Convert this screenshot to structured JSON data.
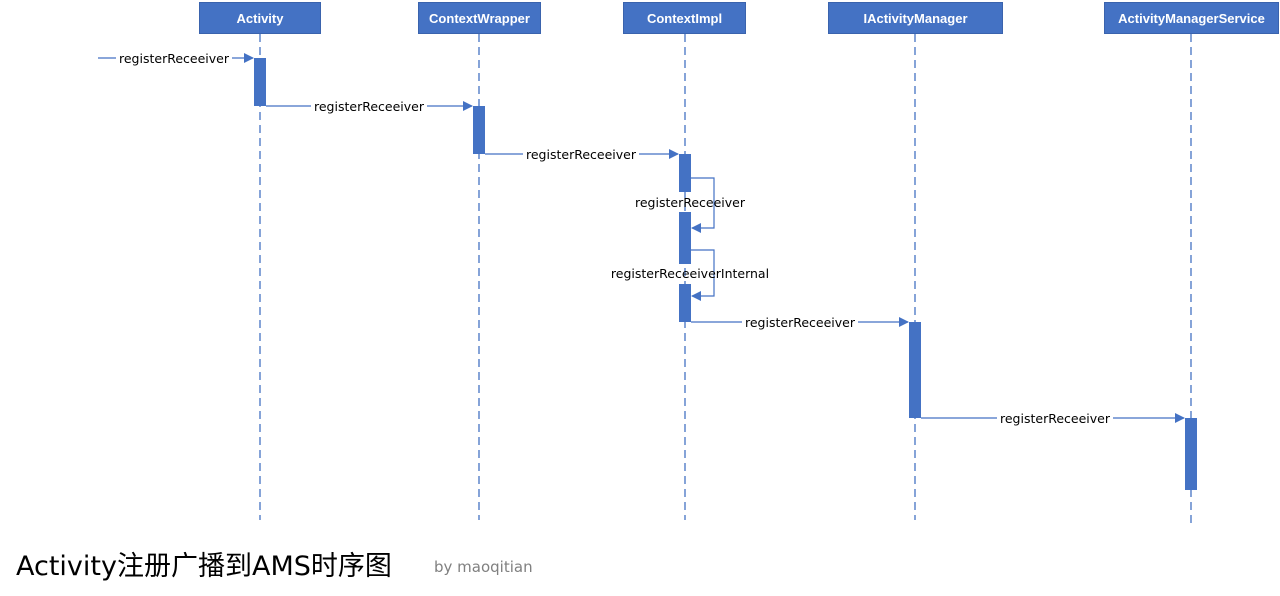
{
  "diagram": {
    "participants": [
      {
        "id": "activity",
        "label": "Activity"
      },
      {
        "id": "contextwrapper",
        "label": "ContextWrapper"
      },
      {
        "id": "contextimpl",
        "label": "ContextImpl"
      },
      {
        "id": "iactivitymanager",
        "label": "IActivityManager"
      },
      {
        "id": "ams",
        "label": "ActivityManagerService"
      }
    ],
    "messages": [
      {
        "from": "external",
        "to": "activity",
        "label": "registerReceeiver"
      },
      {
        "from": "activity",
        "to": "contextwrapper",
        "label": "registerReceeiver"
      },
      {
        "from": "contextwrapper",
        "to": "contextimpl",
        "label": "registerReceeiver"
      },
      {
        "from": "contextimpl",
        "to": "contextimpl",
        "label": "registerReceeiver",
        "self": true
      },
      {
        "from": "contextimpl",
        "to": "contextimpl",
        "label": "registerReceeiverInternal",
        "self": true
      },
      {
        "from": "contextimpl",
        "to": "iactivitymanager",
        "label": "registerReceeiver"
      },
      {
        "from": "iactivitymanager",
        "to": "ams",
        "label": "registerReceeiver"
      }
    ],
    "colors": {
      "accent": "#4472c4"
    }
  },
  "footer": {
    "title": "Activity注册广播到AMS时序图",
    "byline": "by  maoqitian"
  }
}
